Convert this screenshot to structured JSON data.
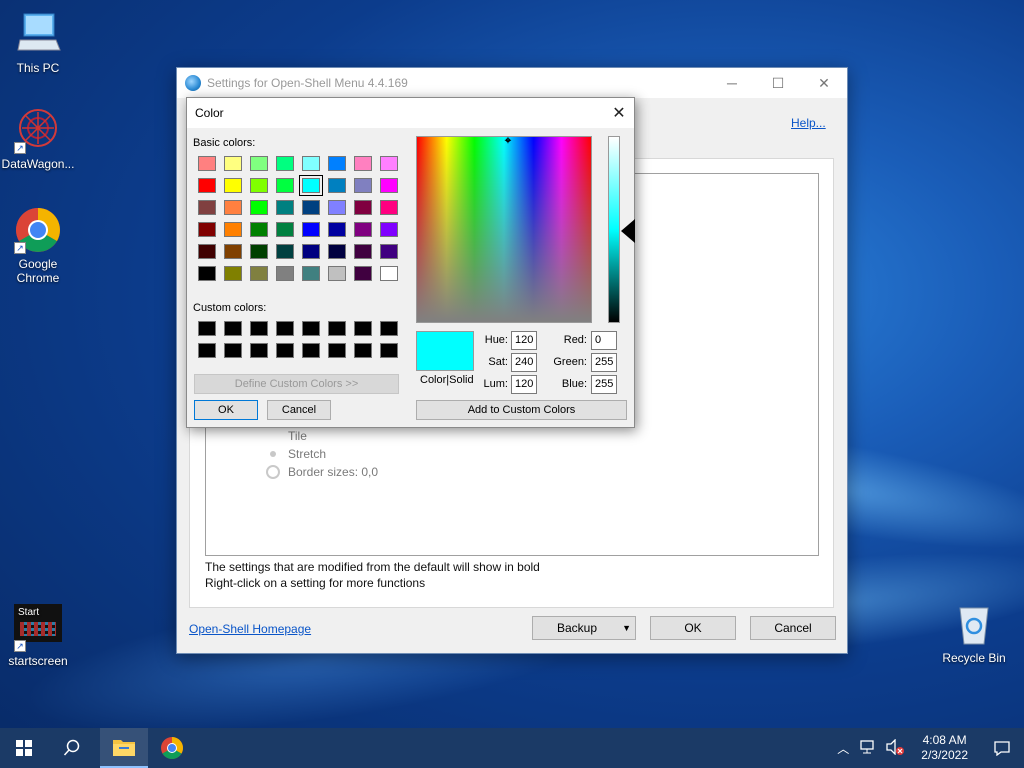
{
  "desktop": {
    "icons": [
      {
        "label": "This PC"
      },
      {
        "label": "DataWagon..."
      },
      {
        "label": "Google\nChrome"
      },
      {
        "label": "startscreen",
        "thumb_text": "Start"
      },
      {
        "label": "Recycle Bin"
      }
    ]
  },
  "main_window": {
    "title": "Settings for Open-Shell Menu 4.4.169",
    "help_link": "Help...",
    "tree_items": [
      "Tile",
      "Stretch",
      "Border sizes: 0,0"
    ],
    "info_line1": "The settings that are modified from the default will show in bold",
    "info_line2": "Right-click on a setting for more functions",
    "homepage_link": "Open-Shell Homepage",
    "backup_button": "Backup",
    "ok_button": "OK",
    "cancel_button": "Cancel"
  },
  "color_dialog": {
    "title": "Color",
    "basic_colors_label": "Basic colors:",
    "custom_colors_label": "Custom colors:",
    "basic_colors": [
      "#ff8080",
      "#ffff80",
      "#80ff80",
      "#00ff80",
      "#80ffff",
      "#0080ff",
      "#ff80c0",
      "#ff80ff",
      "#ff0000",
      "#ffff00",
      "#80ff00",
      "#00ff40",
      "#00ffff",
      "#0080c0",
      "#8080c0",
      "#ff00ff",
      "#804040",
      "#ff8040",
      "#00ff00",
      "#008080",
      "#004080",
      "#8080ff",
      "#800040",
      "#ff0080",
      "#800000",
      "#ff8000",
      "#008000",
      "#008040",
      "#0000ff",
      "#0000a0",
      "#800080",
      "#8000ff",
      "#400000",
      "#804000",
      "#004000",
      "#004040",
      "#000080",
      "#000040",
      "#400040",
      "#400080",
      "#000000",
      "#808000",
      "#808040",
      "#808080",
      "#408080",
      "#c0c0c0",
      "#400040",
      "#ffffff"
    ],
    "selected_index": 12,
    "custom_colors": [
      "#000000",
      "#000000",
      "#000000",
      "#000000",
      "#000000",
      "#000000",
      "#000000",
      "#000000",
      "#000000",
      "#000000",
      "#000000",
      "#000000",
      "#000000",
      "#000000",
      "#000000",
      "#000000"
    ],
    "define_custom_button": "Define Custom Colors >>",
    "ok_button": "OK",
    "cancel_button": "Cancel",
    "preview_label": "Color|Solid",
    "preview_color": "#00ffff",
    "hue_label": "Hue:",
    "hue": "120",
    "sat_label": "Sat:",
    "sat": "240",
    "lum_label": "Lum:",
    "lum": "120",
    "red_label": "Red:",
    "red": "0",
    "green_label": "Green:",
    "green": "255",
    "blue_label": "Blue:",
    "blue": "255",
    "add_custom_button": "Add to Custom Colors"
  },
  "taskbar": {
    "time": "4:08 AM",
    "date": "2/3/2022"
  }
}
